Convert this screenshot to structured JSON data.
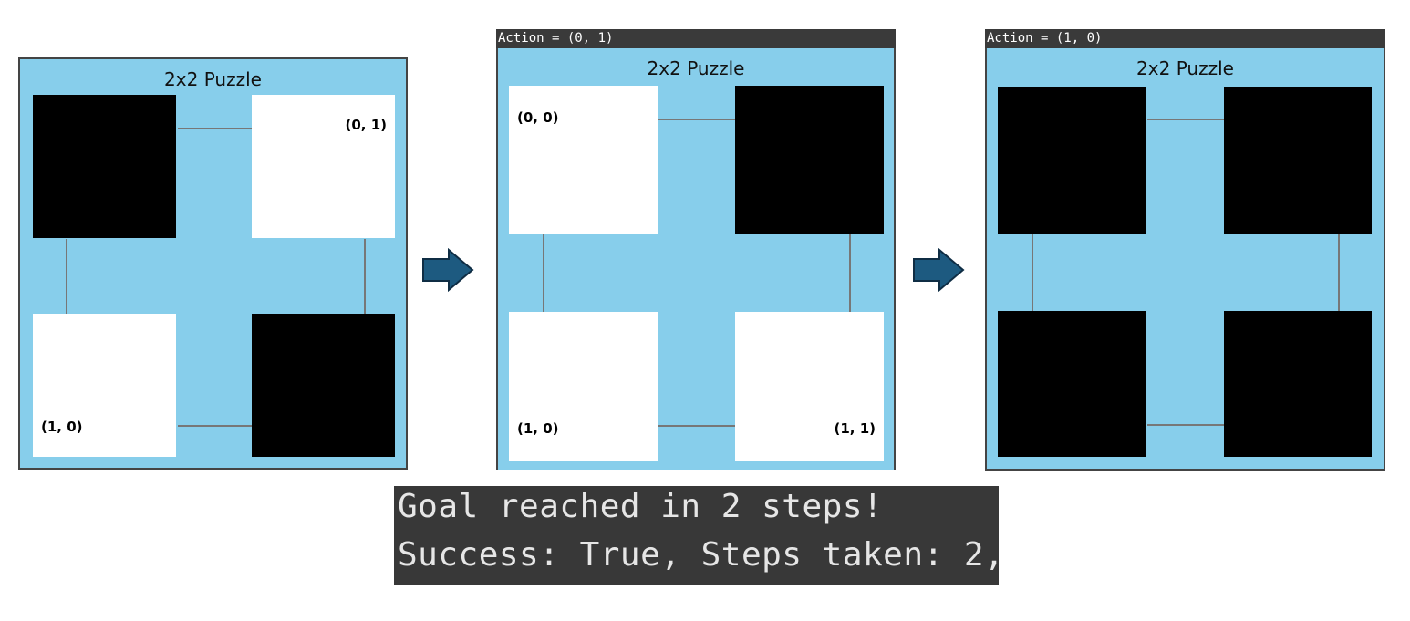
{
  "panels": [
    {
      "action_label": "",
      "title": "2x2 Puzzle",
      "cells": [
        {
          "state": "off",
          "label": ""
        },
        {
          "state": "on",
          "label": "(0, 1)"
        },
        {
          "state": "on",
          "label": "(1, 0)"
        },
        {
          "state": "off",
          "label": ""
        }
      ]
    },
    {
      "action_label": "Action = (0, 1)",
      "title": "2x2 Puzzle",
      "cells": [
        {
          "state": "on",
          "label": "(0, 0)"
        },
        {
          "state": "off",
          "label": ""
        },
        {
          "state": "on",
          "label": "(1, 0)"
        },
        {
          "state": "on",
          "label": "(1, 1)"
        }
      ]
    },
    {
      "action_label": "Action = (1, 0)",
      "title": "2x2 Puzzle",
      "cells": [
        {
          "state": "off",
          "label": ""
        },
        {
          "state": "off",
          "label": ""
        },
        {
          "state": "off",
          "label": ""
        },
        {
          "state": "off",
          "label": ""
        }
      ]
    }
  ],
  "console": {
    "line1": "Goal reached in 2 steps!",
    "line2": "Success: True, Steps taken: 2,"
  },
  "colors": {
    "board_background": "#87ceeb",
    "cell_on": "#ffffff",
    "cell_off": "#000000",
    "arrow_fill": "#1d5a80",
    "arrow_stroke": "#0f2d44",
    "console_background": "#383838"
  }
}
